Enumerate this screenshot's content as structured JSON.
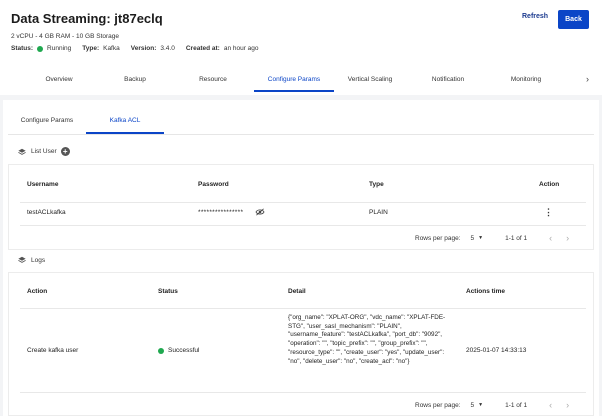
{
  "header": {
    "title": "Data Streaming: jt87eclq",
    "spec": "2 vCPU - 4 GB RAM - 10 GB Storage",
    "status_label": "Status:",
    "status_value": "Running",
    "status_color": "#1fa84f",
    "type_label": "Type:",
    "type_value": "Kafka",
    "version_label": "Version:",
    "version_value": "3.4.0",
    "created_label": "Created at:",
    "created_value": "an hour ago",
    "refresh_label": "Refresh",
    "back_label": "Back"
  },
  "tabs": [
    "Overview",
    "Backup",
    "Resource",
    "Configure Params",
    "Vertical Scaling",
    "Notification",
    "Monitoring"
  ],
  "active_tab": "Configure Params",
  "subtabs": [
    "Configure Params",
    "Kafka ACL"
  ],
  "active_subtab": "Kafka ACL",
  "users": {
    "title": "List User",
    "columns": {
      "username": "Username",
      "password": "Password",
      "type": "Type",
      "action": "Action"
    },
    "rows": [
      {
        "username": "testACLkafka",
        "password": "****************",
        "type": "PLAIN"
      }
    ],
    "pager": {
      "rows_label": "Rows per page:",
      "rows_value": "5",
      "range": "1-1 of 1"
    }
  },
  "logs": {
    "title": "Logs",
    "columns": {
      "action": "Action",
      "status": "Status",
      "detail": "Detail",
      "time": "Actions time"
    },
    "rows": [
      {
        "action": "Create kafka user",
        "status": "Successful",
        "detail": "{\"org_name\": \"XPLAT-ORG\", \"vdc_name\": \"XPLAT-FDE-STG\", \"user_sasl_mechanism\": \"PLAIN\", \"username_feature\": \"testACLkafka\", \"port_db\": \"9092\", \"operation\": \"\", \"topic_prefix\": \"\", \"group_prefix\": \"\", \"resource_type\": \"\", \"create_user\": \"yes\", \"update_user\": \"no\", \"delete_user\": \"no\", \"create_acl\": \"no\"}",
        "time": "2025-01-07 14:33:13"
      }
    ],
    "pager": {
      "rows_label": "Rows per page:",
      "rows_value": "5",
      "range": "1-1 of 1"
    }
  },
  "colors": {
    "accent": "#0b45c7",
    "success": "#1fa84f"
  }
}
